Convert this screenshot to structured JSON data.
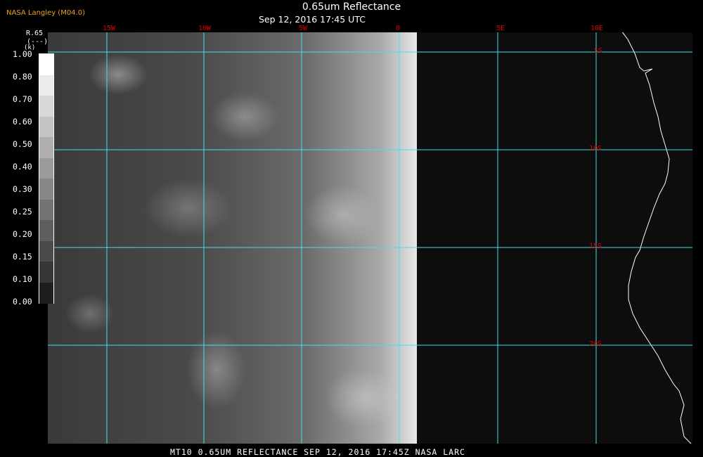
{
  "header": {
    "credit": "NASA Langley (M04.0)",
    "title": "0.65um Reflectance",
    "subtitle": "Sep 12, 2016 17:45 UTC"
  },
  "legend": {
    "name": "R.65",
    "unit_line": "(---)",
    "unit_sub": "(k)",
    "ticks": [
      "1.00",
      "0.80",
      "0.70",
      "0.60",
      "0.50",
      "0.40",
      "0.30",
      "0.25",
      "0.20",
      "0.15",
      "0.10",
      "0.00"
    ],
    "shades": [
      "#ffffff",
      "#ebebeb",
      "#d7d7d7",
      "#c3c3c3",
      "#afafaf",
      "#9b9b9b",
      "#878787",
      "#737373",
      "#5f5f5f",
      "#4b4b4b",
      "#373737",
      "#1e1e1e"
    ]
  },
  "map": {
    "longitude_labels": [
      "15W",
      "10W",
      "5W",
      "0",
      "5E",
      "10E"
    ],
    "latitude_labels": [
      "5S",
      "10S",
      "15S",
      "20S"
    ],
    "colors": {
      "grid": "#40e0f0",
      "grid_label": "#dd0000",
      "coastline": "#ffffff"
    }
  },
  "footer": {
    "caption": "MT10  0.65UM REFLECTANCE   SEP 12, 2016 17:45Z   NASA LARC"
  }
}
